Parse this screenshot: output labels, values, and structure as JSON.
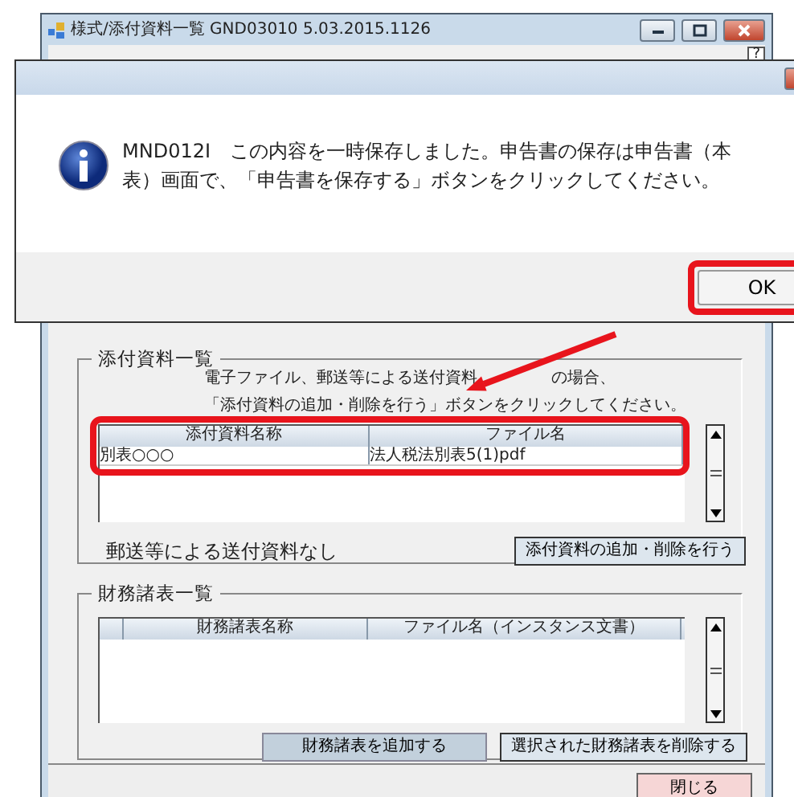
{
  "main_window": {
    "title": "様式/添付資料一覧 GND03010  5.03.2015.1126",
    "help_button": "?"
  },
  "attachments": {
    "title": "添付資料一覧",
    "instructions": [
      [
        "電子ファイル、郵送等による送付資料",
        "の場合、"
      ],
      [
        "「添付資料の追加・削除を行う」ボタンをクリックしてください。"
      ]
    ],
    "columns": [
      "添付資料名称",
      "ファイル名"
    ],
    "rows": [
      [
        "別表○○○",
        "法人税法別表5(1)pdf"
      ]
    ],
    "mail_note": "郵送等による送付資料なし",
    "button": "添付資料の追加・削除を行う"
  },
  "financial": {
    "title": "財務諸表一覧",
    "columns": [
      "財務諸表名称",
      "ファイル名（インスタンス文書）"
    ],
    "buttons": [
      "財務諸表を追加する",
      "選択された財務諸表を削除する"
    ]
  },
  "close_button": "閉じる",
  "dialog": {
    "message": "MND012I　この内容を一時保存しました。申告書の保存は申告書（本表）画面で、「申告書を保存する」ボタンをクリックしてください。",
    "ok_button": "OK"
  },
  "annotations": {
    "highlight_ok": true,
    "highlight_grid": true,
    "arrow": true
  }
}
